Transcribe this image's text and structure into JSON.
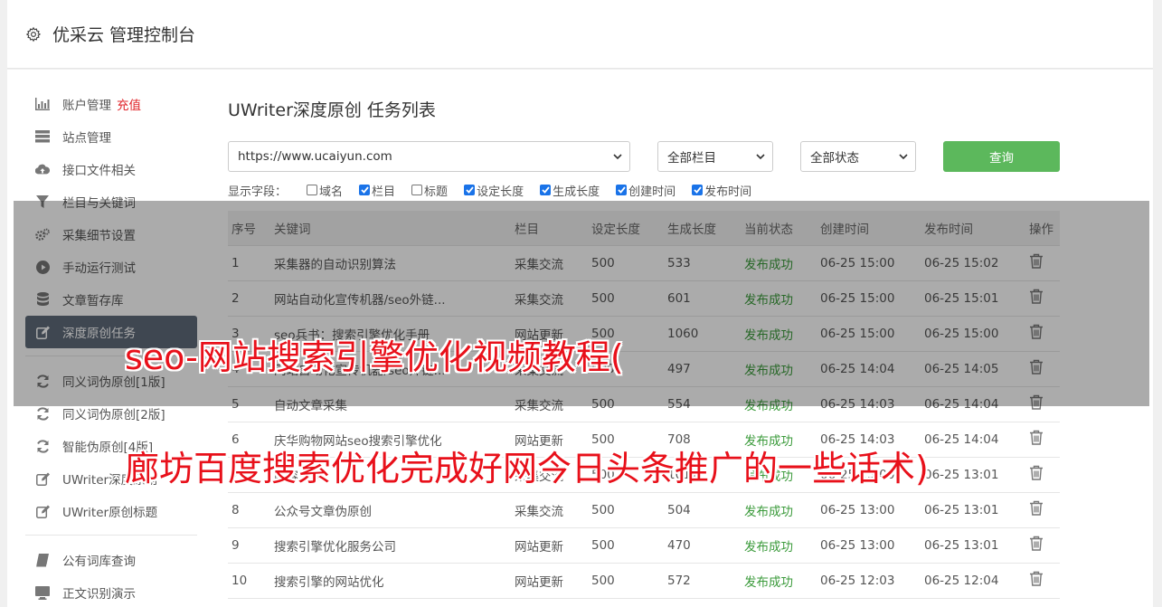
{
  "header": {
    "title": "优采云 管理控制台"
  },
  "sidebar": {
    "recharge": "充值",
    "items": [
      {
        "label": "账户管理",
        "icon": "bar-chart-icon"
      },
      {
        "label": "站点管理",
        "icon": "server-icon"
      },
      {
        "label": "接口文件相关",
        "icon": "cloud-upload-icon"
      },
      {
        "label": "栏目与关键词",
        "icon": "filter-icon"
      },
      {
        "label": "采集细节设置",
        "icon": "cogs-icon"
      },
      {
        "label": "手动运行测试",
        "icon": "play-circle-icon"
      },
      {
        "label": "文章暂存库",
        "icon": "database-icon"
      },
      {
        "label": "深度原创任务",
        "icon": "edit-icon"
      },
      {
        "label": "同义词伪原创[1版]",
        "icon": "refresh-icon"
      },
      {
        "label": "同义词伪原创[2版]",
        "icon": "refresh-icon"
      },
      {
        "label": "智能伪原创[4版]",
        "icon": "refresh-icon"
      },
      {
        "label": "UWriter深度原创",
        "icon": "edit-icon"
      },
      {
        "label": "UWriter原创标题",
        "icon": "edit-icon"
      },
      {
        "label": "公有词库查询",
        "icon": "book-icon"
      },
      {
        "label": "正文识别演示",
        "icon": "monitor-icon"
      }
    ]
  },
  "main": {
    "title": "UWriter深度原创 任务列表",
    "site_select": "https://www.ucaiyun.com",
    "column_select": "全部栏目",
    "status_select": "全部状态",
    "query_label": "查询",
    "fields_label": "显示字段：",
    "fields": [
      {
        "label": "域名",
        "checked": false
      },
      {
        "label": "栏目",
        "checked": true
      },
      {
        "label": "标题",
        "checked": false
      },
      {
        "label": "设定长度",
        "checked": true
      },
      {
        "label": "生成长度",
        "checked": true
      },
      {
        "label": "创建时间",
        "checked": true
      },
      {
        "label": "发布时间",
        "checked": true
      }
    ],
    "columns": [
      "序号",
      "关键词",
      "栏目",
      "设定长度",
      "生成长度",
      "当前状态",
      "创建时间",
      "发布时间",
      "操作"
    ],
    "rows": [
      [
        "1",
        "采集器的自动识别算法",
        "采集交流",
        "500",
        "533",
        "发布成功",
        "06-25 15:00",
        "06-25 15:02"
      ],
      [
        "2",
        "网站自动化宣传机器/seo外链...",
        "采集交流",
        "500",
        "601",
        "发布成功",
        "06-25 15:00",
        "06-25 15:01"
      ],
      [
        "3",
        "seo兵书：搜索引擎优化手册",
        "网站更新",
        "500",
        "1060",
        "发布成功",
        "06-25 15:00",
        "06-25 15:00"
      ],
      [
        "4",
        "网站自动化宣传机器/seo外链...",
        "采集交流",
        "500",
        "497",
        "发布成功",
        "06-25 14:04",
        "06-25 14:05"
      ],
      [
        "5",
        "自动文章采集",
        "采集交流",
        "500",
        "554",
        "发布成功",
        "06-25 14:03",
        "06-25 14:04"
      ],
      [
        "6",
        "庆华购物网站seo搜索引擎优化",
        "网站更新",
        "500",
        "708",
        "发布成功",
        "06-25 14:03",
        "06-25 14:04"
      ],
      [
        "7",
        "内容采集",
        "采集交流",
        "500",
        "1017",
        "发布成功",
        "06-25 13:00",
        "06-25 13:01"
      ],
      [
        "8",
        "公众号文章伪原创",
        "采集交流",
        "500",
        "504",
        "发布成功",
        "06-25 13:00",
        "06-25 13:01"
      ],
      [
        "9",
        "搜索引擎优化服务公司",
        "网站更新",
        "500",
        "470",
        "发布成功",
        "06-25 13:00",
        "06-25 13:01"
      ],
      [
        "10",
        "搜索引擎的网站优化",
        "网站更新",
        "500",
        "572",
        "发布成功",
        "06-25 12:03",
        "06-25 12:04"
      ]
    ]
  },
  "overlay": {
    "line1": "seo-网站搜索引擎优化视频教程(",
    "line2": "廊坊百度搜索优化完成好网今日头条推广的一些话术)"
  },
  "colors": {
    "accent": "#5cb85c",
    "active_nav": "#5f6b7a",
    "success": "#3a9a3a",
    "overlay_text": "#e8101a"
  }
}
